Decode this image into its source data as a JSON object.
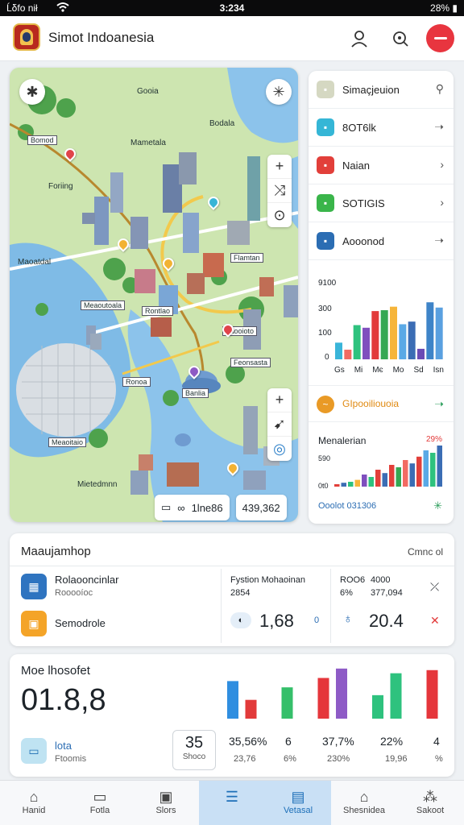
{
  "status": {
    "left": "Ĺδfo nił",
    "time": "3:234",
    "right": "28%"
  },
  "app": {
    "title": "Simot Indoanesia"
  },
  "map": {
    "labels": [
      "Gooia",
      "Bodala",
      "Mametala",
      "Foriing",
      "Maoatdal",
      "Meaoutoala",
      "Ronoa",
      "Meaoitaio",
      "Mietedmnn",
      "Feonsasta",
      "Faooioto",
      "Flamtan",
      "Rontlao",
      "Bomod",
      "Banlia"
    ],
    "footer_label": "1lne86",
    "footer_value": "439,362",
    "footer_prefix": "∞"
  },
  "right_list": [
    {
      "label": "Simaçjeuion",
      "icon": "document-icon",
      "color": "#d5d8c2",
      "chev": "search"
    },
    {
      "label": "8OT6lk",
      "icon": "chat-icon",
      "color": "#35b6d6",
      "chev": "arrow"
    },
    {
      "label": "Naian",
      "icon": "car-icon",
      "color": "#e23f3a",
      "chev": "chevron"
    },
    {
      "label": "SOTIGIS",
      "icon": "leaf-icon",
      "color": "#3ab54a",
      "chev": "chevron"
    },
    {
      "label": "Aooonod",
      "icon": "layers-icon",
      "color": "#2b6db3",
      "chev": "arrow"
    }
  ],
  "right_list_trend": {
    "label": "GIpooiliouoia",
    "color": "#e99a26"
  },
  "mini_chart_1": {
    "chart_data": {
      "type": "bar",
      "title": "",
      "xlabel": "",
      "ylabel": "",
      "ylim": [
        0,
        900
      ],
      "ytick_labels": [
        "9100",
        "300",
        "100",
        "0"
      ],
      "categories": [
        "Gs",
        "Mi",
        "Mє",
        "Mo",
        "Sd",
        "Isn"
      ],
      "values": [
        190,
        110,
        390,
        360,
        550,
        560,
        600,
        400,
        430,
        120,
        650,
        590
      ],
      "colors": [
        "#3ab5d9",
        "#f26b63",
        "#2ec27e",
        "#7f4fbe",
        "#e23a3a",
        "#35a853",
        "#f6b53a",
        "#5aa9e6",
        "#3b6db4",
        "#6b4bb5",
        "#3e84c8",
        "#5aa0e0"
      ]
    }
  },
  "mini_chart_2": {
    "title": "Menalerian",
    "corner": "29%",
    "footer": "Ooolot 031306",
    "chart_data": {
      "type": "bar",
      "title": "",
      "ylabel": "",
      "ytick_labels": [
        "590",
        "0t0"
      ],
      "values": [
        5,
        8,
        10,
        14,
        25,
        20,
        35,
        28,
        45,
        40,
        55,
        48,
        62,
        75,
        70,
        85
      ],
      "colors": [
        "#e23f3a",
        "#3b6db4",
        "#2ec27e",
        "#f6b53a",
        "#7f4fbe",
        "#2ec27e",
        "#e23f3a",
        "#3b6db4",
        "#e23f3a",
        "#35a853",
        "#f26b63",
        "#3b6db4",
        "#e23f3a",
        "#5aa9e6",
        "#2ec27e",
        "#3b6db4"
      ]
    }
  },
  "summary": {
    "title": "Maaujamhop",
    "control": "Cmnc ol",
    "row1": {
      "label": "Rolaooncinlar",
      "sub": "Rooooíoc"
    },
    "row2": {
      "label": "Semodrole"
    },
    "mid_header": "Fystion Mohaoinan",
    "mid_sub": "2854",
    "mid_value": "1,68",
    "mid_badge": "0",
    "c1": [
      "ROO6",
      "6%"
    ],
    "c2": [
      "4000",
      "377,094"
    ],
    "right_value": "20.4"
  },
  "kpi": {
    "title": "Moe lhosofet",
    "big": "01.8,8",
    "chart_data": {
      "type": "bar",
      "values": [
        48,
        24,
        0,
        40,
        0,
        52,
        64,
        0,
        30,
        58,
        0,
        62
      ],
      "colors": [
        "#2f8ee0",
        "#e23a3a",
        "#ffffff",
        "#35bf6a",
        "#ffffff",
        "#e5363b",
        "#8e5bc6",
        "#ffffff",
        "#2ec27e",
        "#2ec27e",
        "#ffffff",
        "#e5363b"
      ]
    },
    "foot_label": "lota",
    "foot_sub": "Ftoomis",
    "box_value": "35",
    "box_label": "Shoco",
    "cols": [
      {
        "top": "35,56%",
        "bot": "23,76"
      },
      {
        "top": "6",
        "bot": "6%"
      },
      {
        "top": "37,7%",
        "bot": "230%"
      },
      {
        "top": "22%",
        "bot": "19,96"
      },
      {
        "top": "4",
        "bot": "%"
      }
    ]
  },
  "tabs": [
    {
      "label": "Hanid",
      "icon": "home-icon"
    },
    {
      "label": "Fotla",
      "icon": "map-icon"
    },
    {
      "label": "Slors",
      "icon": "box-icon"
    },
    {
      "label": "",
      "icon": "list-icon"
    },
    {
      "label": "Vetasal",
      "icon": "book-icon"
    },
    {
      "label": "Shesnidea",
      "icon": "bank-icon"
    },
    {
      "label": "Sakoot",
      "icon": "grid-icon"
    }
  ]
}
